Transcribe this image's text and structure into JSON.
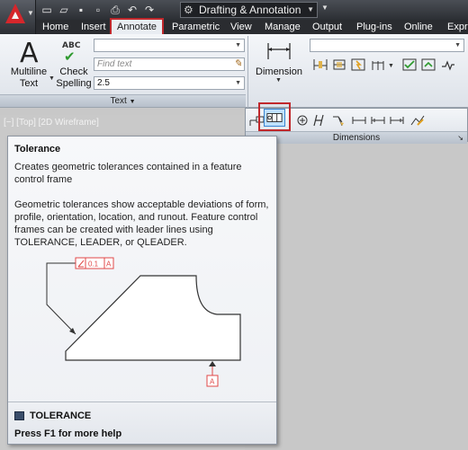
{
  "workspace": {
    "name": "Drafting & Annotation"
  },
  "tabs": [
    "Home",
    "Insert",
    "Annotate",
    "Parametric",
    "View",
    "Manage",
    "Output",
    "Plug-ins",
    "Online",
    "Expre"
  ],
  "active_tab": "Annotate",
  "ribbon": {
    "text_panel": {
      "multiline_text_label": "Multiline Text",
      "check_spelling_label": "Check Spelling",
      "check_spelling_badge": "ABC",
      "find_placeholder": "Find text",
      "text_height_value": "2.5",
      "panel_label": "Text"
    },
    "dimensions_panel": {
      "dimension_label": "Dimension",
      "panel_label": "Dimensions"
    }
  },
  "viewport": {
    "label": "[−] [Top] [2D Wireframe]"
  },
  "tooltip": {
    "title": "Tolerance",
    "description": "Creates geometric tolerances contained in a feature control frame",
    "body": "Geometric tolerances show acceptable deviations of form, profile, orientation, location, and runout. Feature control frames can be created with leader lines using TOLERANCE, LEADER, or QLEADER.",
    "figure": {
      "fcf_value": "0.1",
      "fcf_datum": "A",
      "datum_label": "A"
    },
    "command": "TOLERANCE",
    "help_text": "Press F1 for more help"
  },
  "colors": {
    "highlight": "#c0282c",
    "figure_red": "#e04848"
  }
}
